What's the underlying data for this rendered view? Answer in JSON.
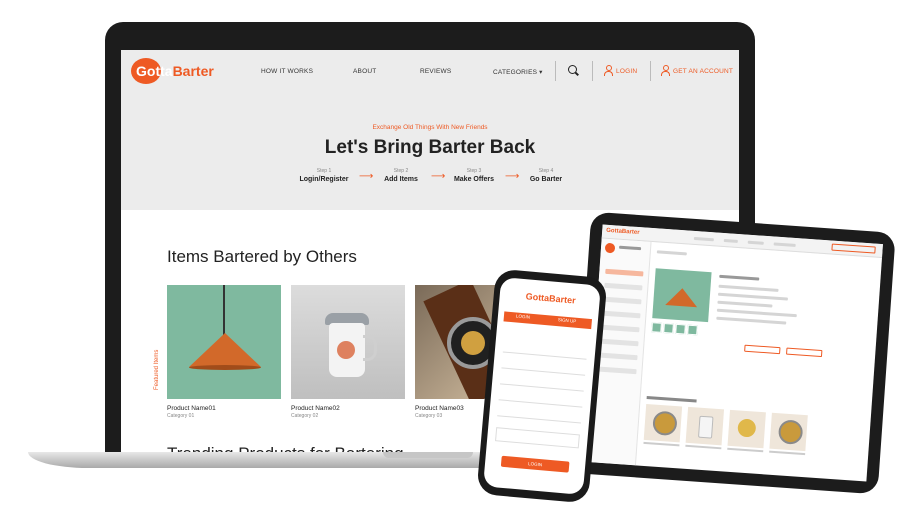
{
  "brand": {
    "logo_part1": "Gotta",
    "logo_part2": "Barter",
    "accent_color": "#ee5a24"
  },
  "nav": {
    "how_it_works": "HOW IT WORKS",
    "about": "ABOUT",
    "reviews": "REVIEWS",
    "categories": "CATEGORIES ▾",
    "search_icon": "search-icon",
    "login": "LOGIN",
    "get_account": "GET AN ACCOUNT"
  },
  "hero": {
    "tagline": "Exchange Old Things With New Friends",
    "headline": "Let's Bring Barter Back",
    "steps": [
      {
        "num": "Step 1",
        "label": "Login/Register"
      },
      {
        "num": "Step 2",
        "label": "Add Items"
      },
      {
        "num": "Step 3",
        "label": "Make Offers"
      },
      {
        "num": "Step 4",
        "label": "Go Barter"
      }
    ],
    "arrow": "⟶"
  },
  "bartered": {
    "title": "Items Bartered by Others",
    "featured_label": "Featured Items",
    "prev_icon": "‹",
    "next_icon": "›",
    "products": [
      {
        "name": "Product Name01",
        "category": "Category 01"
      },
      {
        "name": "Product Name02",
        "category": "Category 02"
      },
      {
        "name": "Product Name03",
        "category": "Category 03"
      }
    ]
  },
  "trending": {
    "title": "Trending Products for Bartering"
  },
  "phone": {
    "tab_left": "LOGIN",
    "tab_right": "SIGN UP",
    "button": "LOGIN"
  }
}
